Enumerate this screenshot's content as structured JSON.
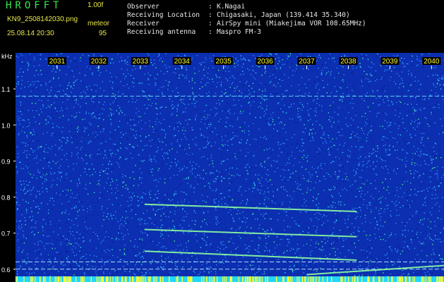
{
  "header": {
    "app_title": "HROFFT",
    "version": "1.00f",
    "filename": "KN9_2508142030.png",
    "mode": "meteor",
    "datetime": "25.08.14 20:30",
    "count": "95",
    "info": [
      {
        "label": "Observer",
        "value": "K.Nagai"
      },
      {
        "label": "Receiving Location",
        "value": "Chigasaki, Japan (139.414 35.340)"
      },
      {
        "label": "Receiver",
        "value": "AirSpy mini (Miakejima VOR 108.65MHz)"
      },
      {
        "label": "Receiving antenna",
        "value": "Maspro FM-3"
      }
    ]
  },
  "chart_data": {
    "type": "heatmap",
    "xlabel": "",
    "ylabel": "kHz",
    "x_ticks": [
      "2031",
      "2032",
      "2033",
      "2034",
      "2035",
      "2036",
      "2037",
      "2038",
      "2039",
      "2040"
    ],
    "y_ticks": [
      "1.1",
      "1.0",
      "0.9",
      "0.8",
      "0.7",
      "0.6"
    ],
    "ylim": [
      0.58,
      1.2
    ],
    "xlim_minutes": [
      2030,
      2040.3
    ],
    "noise_color": "#0b2fb0",
    "speckle_colors": [
      "#2f8cff",
      "#33d8e8",
      "#47ff7a",
      "#0a1a90"
    ],
    "trace_color": "#8effa0",
    "marker_color": "#ffff33",
    "bottom_strip_color": "#22d6ff",
    "carriers_khz": [
      1.08,
      0.62,
      0.6
    ],
    "echo_traces": [
      {
        "x_start": 2033.1,
        "y_start": 0.78,
        "x_end": 2038.2,
        "y_end": 0.76
      },
      {
        "x_start": 2033.1,
        "y_start": 0.71,
        "x_end": 2038.2,
        "y_end": 0.69
      },
      {
        "x_start": 2033.1,
        "y_start": 0.65,
        "x_end": 2038.2,
        "y_end": 0.625
      },
      {
        "x_start": 2037.0,
        "y_start": 0.585,
        "x_end": 2040.3,
        "y_end": 0.61
      }
    ]
  }
}
